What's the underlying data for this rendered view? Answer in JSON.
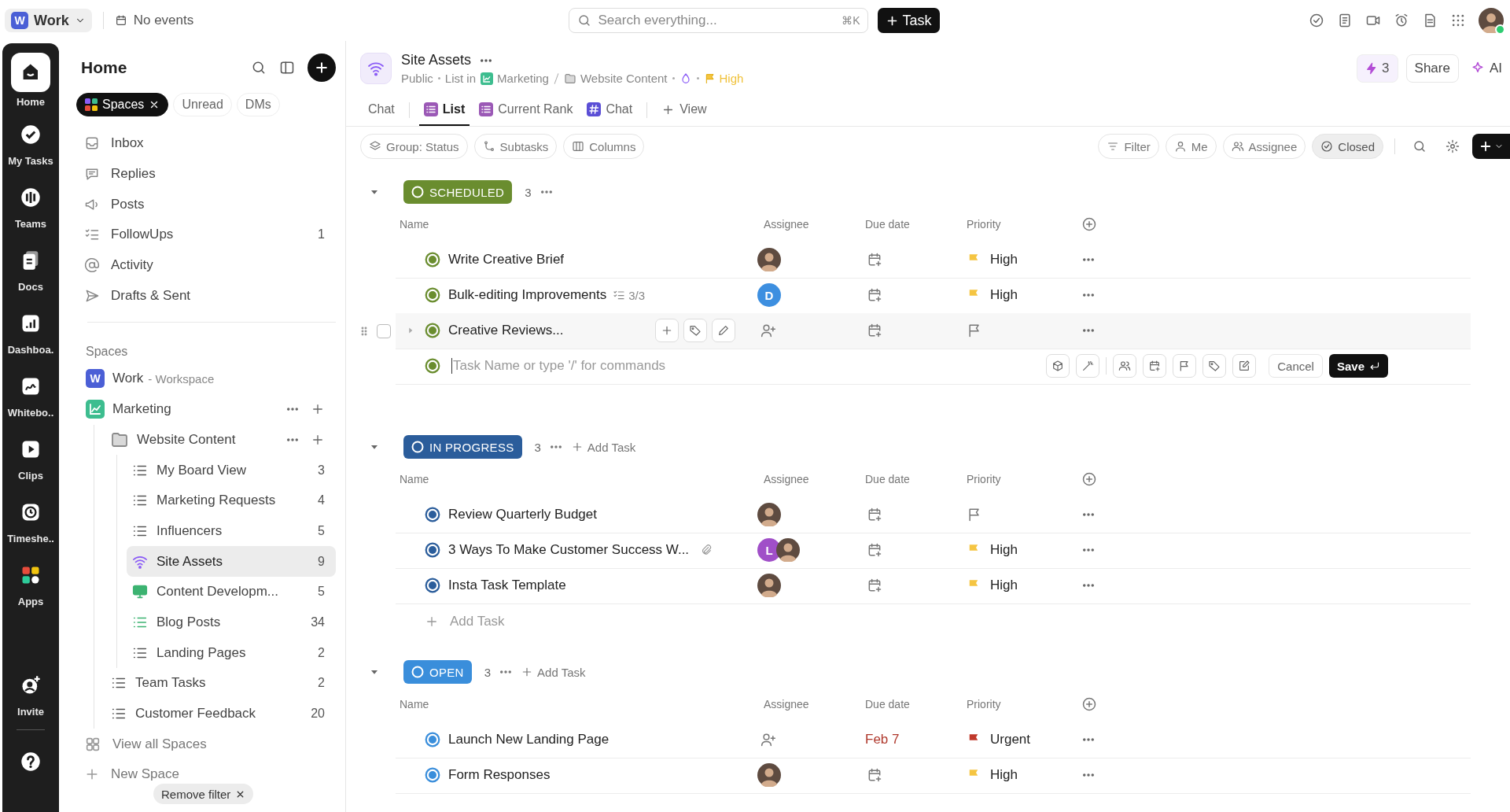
{
  "top_bar": {
    "workspace": "Work",
    "workspace_badge": "W",
    "calendar": "No events",
    "search": {
      "placeholder": "Search everything...",
      "shortcut": "⌘K"
    },
    "task_button": "Task"
  },
  "rail": [
    {
      "label": "Home",
      "kind": "home",
      "selected": true
    },
    {
      "label": "My Tasks",
      "kind": "tasks",
      "selected": false
    },
    {
      "label": "Teams",
      "kind": "teams",
      "selected": false
    },
    {
      "label": "Docs",
      "kind": "docs",
      "selected": false
    },
    {
      "label": "Dashboa.",
      "kind": "dashboards",
      "selected": false
    },
    {
      "label": "Whitebo..",
      "kind": "whiteboards",
      "selected": false
    },
    {
      "label": "Clips",
      "kind": "clips",
      "selected": false
    },
    {
      "label": "Timeshe..",
      "kind": "timesheets",
      "selected": false
    },
    {
      "label": "Apps",
      "kind": "apps",
      "selected": false
    }
  ],
  "rail_bottom": [
    {
      "label": "Invite",
      "kind": "invite"
    },
    {
      "kind": "help"
    }
  ],
  "sidebar": {
    "title": "Home",
    "filters": [
      {
        "label": "Spaces",
        "selected": true
      },
      {
        "label": "Unread",
        "selected": false
      },
      {
        "label": "DMs",
        "selected": false
      }
    ],
    "nav": [
      {
        "label": "Inbox",
        "kind": "inbox"
      },
      {
        "label": "Replies",
        "kind": "replies"
      },
      {
        "label": "Posts",
        "kind": "posts"
      },
      {
        "label": "FollowUps",
        "kind": "followups",
        "count": "1"
      },
      {
        "label": "Activity",
        "kind": "activity"
      },
      {
        "label": "Drafts & Sent",
        "kind": "drafts"
      }
    ],
    "spaces_heading": "Spaces",
    "tree": [
      {
        "label": "Work",
        "note": "- Workspace",
        "kind": "workspace",
        "badge": "W",
        "color": "#4b5fd6"
      },
      {
        "label": "Marketing",
        "kind": "space",
        "color": "#3dbd8f",
        "children": [
          {
            "label": "Website Content",
            "kind": "folder",
            "children": [
              {
                "label": "My Board View",
                "kind": "list",
                "count": "3",
                "color": "#555555",
                "selected": false
              },
              {
                "label": "Marketing Requests",
                "kind": "list",
                "count": "4",
                "color": "#555555",
                "selected": false
              },
              {
                "label": "Influencers",
                "kind": "list",
                "count": "5",
                "color": "#555555",
                "selected": false
              },
              {
                "label": "Site Assets",
                "kind": "wifi",
                "count": "9",
                "color": "#8b5cf6",
                "selected": true
              },
              {
                "label": "Content Developm...",
                "kind": "monitor",
                "count": "5",
                "color": "#3cb371",
                "selected": false
              },
              {
                "label": "Blog Posts",
                "kind": "list",
                "count": "34",
                "color": "#3cb371",
                "selected": false
              },
              {
                "label": "Landing Pages",
                "kind": "list",
                "count": "2",
                "color": "#555555",
                "selected": false
              }
            ]
          },
          {
            "label": "Team Tasks",
            "kind": "list",
            "count": "2",
            "color": "#555555"
          },
          {
            "label": "Customer Feedback",
            "kind": "list",
            "count": "20",
            "color": "#555555"
          }
        ]
      }
    ],
    "view_all": "View all Spaces",
    "new_space": "New Space",
    "remove_filter": "Remove filter"
  },
  "header": {
    "title": "Site Assets",
    "breadcrumb": {
      "visibility": "Public",
      "location": "List in",
      "space": "Marketing",
      "folder": "Website Content",
      "priority": "High"
    },
    "automations": "3",
    "share": "Share",
    "ai": "AI"
  },
  "tabs": [
    {
      "label": "Chat",
      "kind": "plain",
      "selected": false
    },
    {
      "label": "List",
      "kind": "list",
      "selected": true
    },
    {
      "label": "Current Rank",
      "kind": "list",
      "selected": false
    },
    {
      "label": "Chat",
      "kind": "hash",
      "selected": false
    },
    {
      "label": "View",
      "kind": "add",
      "selected": false
    }
  ],
  "toolbar": {
    "left": [
      {
        "label": "Group: Status",
        "kind": "layers"
      },
      {
        "label": "Subtasks",
        "kind": "subtasks"
      },
      {
        "label": "Columns",
        "kind": "columns"
      }
    ],
    "right": [
      {
        "label": "Filter",
        "kind": "filter",
        "selected": false
      },
      {
        "label": "Me",
        "kind": "person",
        "selected": false
      },
      {
        "label": "Assignee",
        "kind": "people",
        "selected": false
      },
      {
        "label": "Closed",
        "kind": "check",
        "selected": true
      }
    ]
  },
  "groups": [
    {
      "status": "SCHEDULED",
      "color": "#6a8d2f",
      "count": "3",
      "columns": [
        "Name",
        "Assignee",
        "Due date",
        "Priority"
      ],
      "rows": [
        {
          "name": "Write Creative Brief",
          "hovered": false,
          "attachment": false,
          "assignees": [
            {
              "kind": "photo"
            }
          ],
          "priority": {
            "label": "High",
            "color": "#f5c542"
          }
        },
        {
          "name": "Bulk-editing Improvements",
          "subtasks": "3/3",
          "hovered": false,
          "attachment": false,
          "assignees": [
            {
              "kind": "letter",
              "letter": "D",
              "color": "#3d8fe0"
            }
          ],
          "priority": {
            "label": "High",
            "color": "#f5c542"
          }
        },
        {
          "name": "Creative Reviews...",
          "hovered": true,
          "checked": false,
          "attachment": false
        }
      ],
      "new_task": {
        "placeholder": "Task Name or type '/' for commands",
        "cancel": "Cancel",
        "save": "Save"
      }
    },
    {
      "status": "IN PROGRESS",
      "color": "#2b5d9b",
      "count": "3",
      "add_task": "Add Task",
      "columns": [
        "Name",
        "Assignee",
        "Due date",
        "Priority"
      ],
      "rows": [
        {
          "name": "Review Quarterly Budget",
          "hovered": false,
          "attachment": false,
          "assignees": [
            {
              "kind": "photo"
            }
          ]
        },
        {
          "name": "3 Ways To Make Customer Success W...",
          "hovered": false,
          "attachment": true,
          "assignees": [
            {
              "kind": "letter",
              "letter": "L",
              "color": "#a04fc8"
            },
            {
              "kind": "photo"
            }
          ],
          "priority": {
            "label": "High",
            "color": "#f5c542"
          }
        },
        {
          "name": "Insta Task Template",
          "hovered": false,
          "attachment": false,
          "assignees": [
            {
              "kind": "photo"
            }
          ],
          "priority": {
            "label": "High",
            "color": "#f5c542"
          }
        }
      ],
      "add_task_row": "Add Task"
    },
    {
      "status": "OPEN",
      "color": "#3a8edb",
      "count": "3",
      "add_task": "Add Task",
      "columns": [
        "Name",
        "Assignee",
        "Due date",
        "Priority"
      ],
      "rows": [
        {
          "name": "Launch New Landing Page",
          "hovered": false,
          "attachment": false,
          "due": "Feb 7",
          "priority": {
            "label": "Urgent",
            "color": "#c0392b"
          }
        },
        {
          "name": "Form Responses",
          "hovered": false,
          "attachment": false,
          "assignees": [
            {
              "kind": "photo"
            }
          ],
          "priority": {
            "label": "High",
            "color": "#f5c542"
          }
        }
      ]
    }
  ]
}
